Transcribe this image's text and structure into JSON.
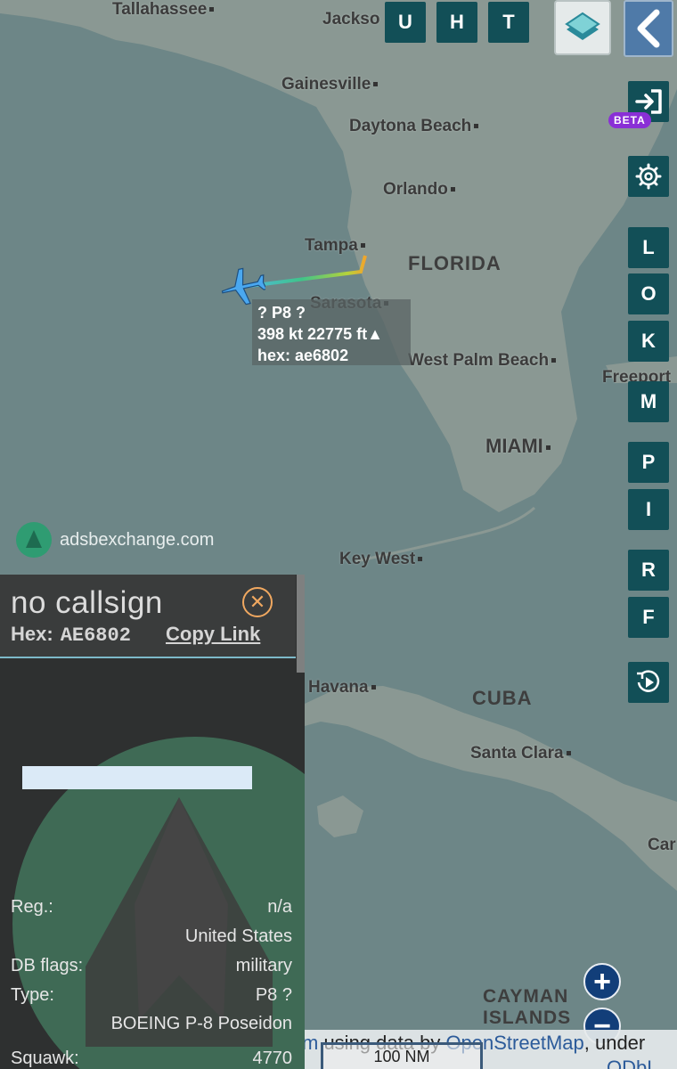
{
  "top_buttons": [
    "U",
    "H",
    "T"
  ],
  "side_buttons": [
    "L",
    "O",
    "K",
    "M",
    "P",
    "I",
    "R",
    "F"
  ],
  "beta_badge": "BETA",
  "map": {
    "cities": {
      "tallahassee": "Tallahassee",
      "jacksonville": "Jackso",
      "gainesville": "Gainesville",
      "daytona": "Daytona Beach",
      "orlando": "Orlando",
      "tampa": "Tampa",
      "sarasota": "Sarasota",
      "west_palm": "West Palm Beach",
      "freeport": "Freeport",
      "miami": "MIAMI",
      "key_west": "Key West",
      "havana": "Havana",
      "santa_clara": "Santa Clara",
      "cayman1": "CAYMAN",
      "cayman2": "ISLANDS",
      "camaguey": "Car"
    },
    "regions": {
      "florida": "FLORIDA",
      "cuba": "CUBA"
    }
  },
  "aircraft_label": {
    "line1": "?   P8 ?",
    "line2": "398 kt  22775 ft▲",
    "line3": "hex: ae6802"
  },
  "logo_text": "adsbexchange.com",
  "attribution": {
    "prefix": "m",
    "text": " using data by ",
    "link": "OpenStreetMap",
    "suffix": ", under",
    "line2": "ODbL"
  },
  "scale": "100 NM",
  "zoom": {
    "in": "+",
    "out": "−"
  },
  "panel": {
    "callsign": "no callsign",
    "hex_label": "Hex:",
    "hex_value": "AE6802",
    "copy_link": "Copy Link",
    "close": "✕",
    "rows": [
      {
        "k": "Reg.:",
        "v": "n/a"
      },
      {
        "k": "",
        "v": "United States"
      },
      {
        "k": "DB flags:",
        "v": "military"
      },
      {
        "k": "Type:",
        "v": "P8 ?"
      },
      {
        "k": "",
        "v": "BOEING P-8 Poseidon"
      },
      {
        "k": "Squawk:",
        "v": "4770"
      }
    ]
  },
  "colors": {
    "button": "#124f57",
    "panel": "#2e3030",
    "accent": "#f0a860",
    "beta": "#8a2fd6"
  }
}
